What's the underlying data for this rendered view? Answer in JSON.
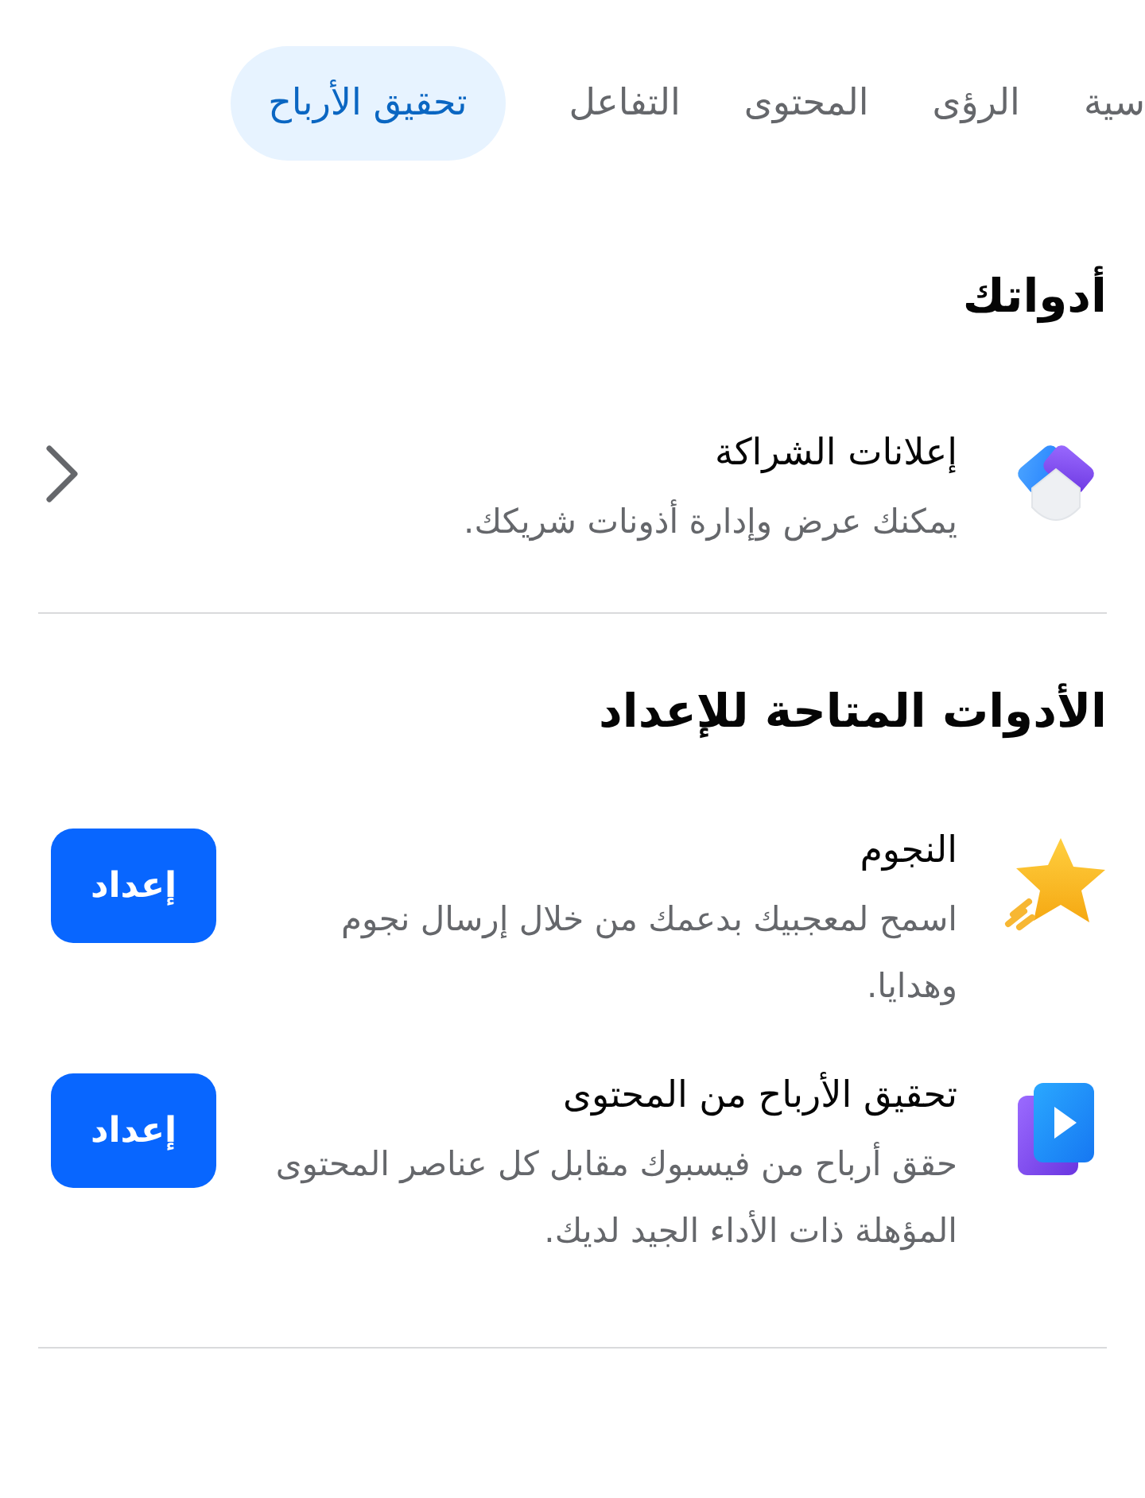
{
  "tabs": [
    {
      "label": "سية",
      "selected": false
    },
    {
      "label": "الرؤى",
      "selected": false
    },
    {
      "label": "المحتوى",
      "selected": false
    },
    {
      "label": "التفاعل",
      "selected": false
    },
    {
      "label": "تحقيق الأرباح",
      "selected": true
    }
  ],
  "sections": [
    {
      "title": "أدواتك",
      "items": [
        {
          "kind": "link",
          "title": "إعلانات الشراكة",
          "description": "يمكنك عرض وإدارة أذونات شريكك."
        }
      ]
    },
    {
      "title": "الأدوات المتاحة للإعداد",
      "items": [
        {
          "kind": "setup",
          "title": "النجوم",
          "description": "اسمح لمعجبيك بدعمك من خلال إرسال نجوم وهدايا.",
          "button": "إعداد"
        },
        {
          "kind": "setup",
          "title": "تحقيق الأرباح من المحتوى",
          "description": "حقق أرباح من فيسبوك مقابل كل عناصر المحتوى المؤهلة ذات الأداء الجيد لديك.",
          "button": "إعداد"
        }
      ]
    }
  ]
}
